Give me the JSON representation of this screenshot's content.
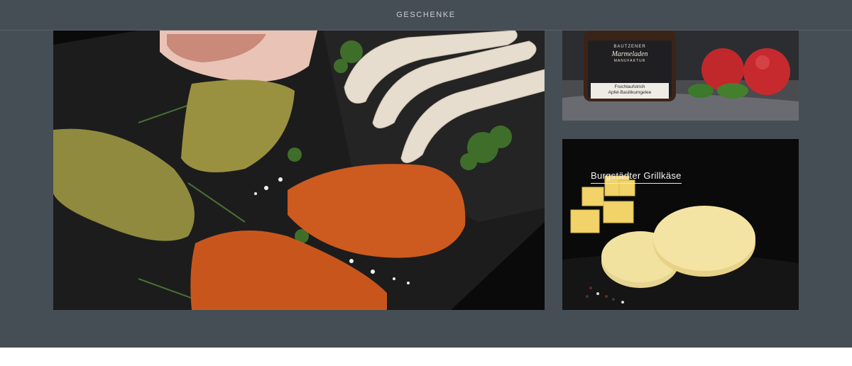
{
  "nav": {
    "gift_link": "GESCHENKE"
  },
  "tiles": {
    "meat": {
      "alt": ""
    },
    "jam": {
      "brand": "BAUTZENER",
      "script": "Marmeladen",
      "subbrand": "MANUFAKTUR",
      "product_line1": "Fruchtaufstrich",
      "product_line2": "Apfel-Basilikumgelee"
    },
    "cheese": {
      "title": "Burgstädter Grillkäse"
    }
  },
  "colors": {
    "band": "#464e55",
    "nav_text": "#c9ced3",
    "page": "#ffffff"
  }
}
